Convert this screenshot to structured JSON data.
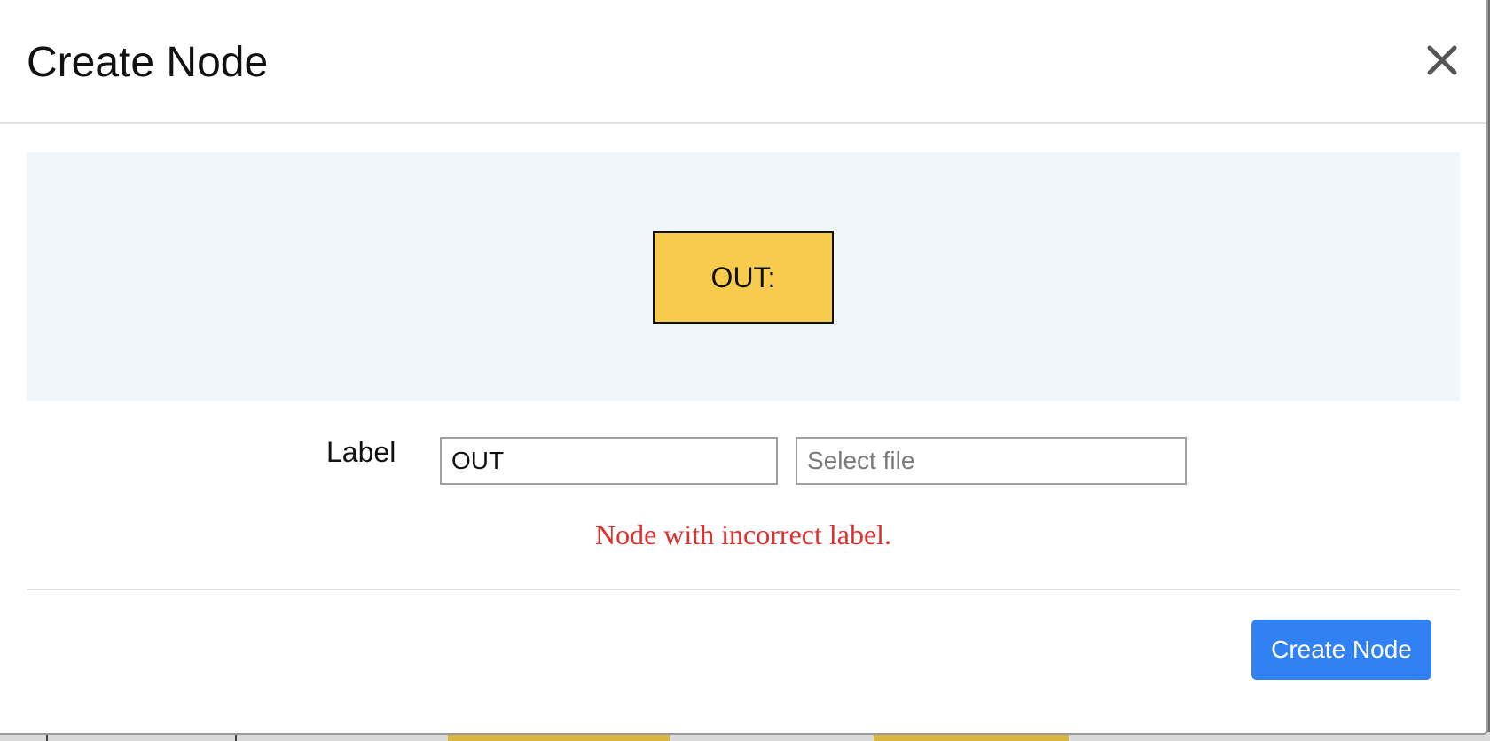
{
  "modal": {
    "title": "Create Node",
    "close_icon": "close-icon"
  },
  "preview": {
    "node_text": "OUT:",
    "node_color": "#f7cb4d",
    "background_color": "#eff6fc"
  },
  "form": {
    "label_text": "Label",
    "label_value": "OUT",
    "file_placeholder": "Select file"
  },
  "error": {
    "message": "Node with incorrect label.",
    "color": "#e0302c"
  },
  "footer": {
    "create_button_label": "Create Node",
    "accent_color": "#3281f3"
  }
}
